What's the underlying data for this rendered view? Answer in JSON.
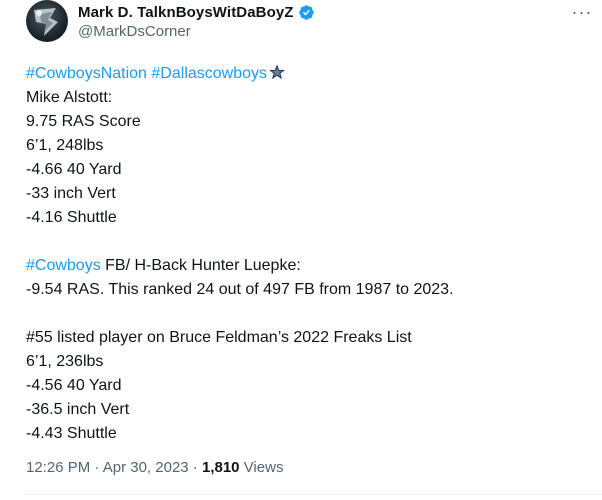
{
  "author": {
    "display_name": "Mark D. TalknBoysWitDaBoyZ",
    "handle": "@MarkDsCorner",
    "verified_icon": "verified-badge-icon",
    "verified_color": "#1d9bf0"
  },
  "more_icon": "more-options-icon",
  "more_label": "···",
  "colors": {
    "hashtag": "#1d9bf0",
    "text": "#0f1419",
    "muted": "#536471"
  },
  "body": {
    "hashtag_1": "#CowboysNation",
    "hashtag_2": "#Dallascowboys",
    "star_icon": "star-icon",
    "p1": {
      "l1": "Mike Alstott:",
      "l2": "9.75 RAS Score",
      "l3": "6’1, 248lbs",
      "l4": "-4.66 40 Yard",
      "l5": "-33 inch Vert",
      "l6": "-4.16 Shuttle"
    },
    "p2": {
      "hashtag": "#Cowboys",
      "l1_rest": " FB/ H-Back Hunter Luepke:",
      "l2": "-9.54 RAS. This ranked 24 out of 497 FB from 1987 to 2023."
    },
    "p3": {
      "l1": "#55 listed player on Bruce Feldman’s 2022 Freaks List",
      "l2": "6’1, 236lbs",
      "l3": "-4.56 40 Yard",
      "l4": "-36.5 inch Vert",
      "l5": "-4.43 Shuttle"
    }
  },
  "meta": {
    "time": "12:26 PM",
    "sep": " · ",
    "date": "Apr 30, 2023",
    "views_count": "1,810",
    "views_label": " Views"
  }
}
